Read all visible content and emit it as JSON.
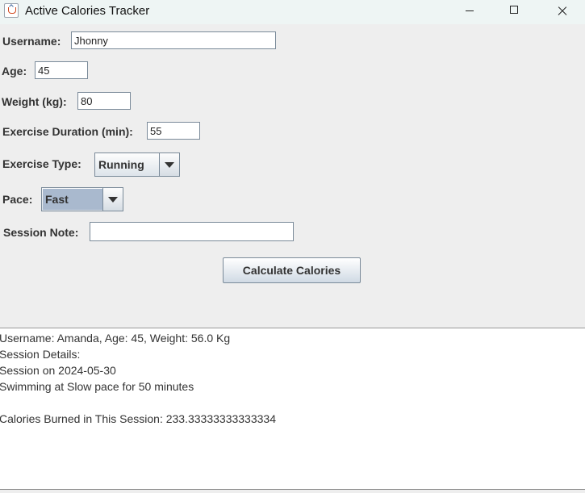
{
  "window": {
    "title": "Active Calories Tracker"
  },
  "form": {
    "username_label": "Username:",
    "username_value": "Jhonny",
    "age_label": "Age:",
    "age_value": "45",
    "weight_label": "Weight (kg):",
    "weight_value": "80",
    "duration_label": "Exercise Duration (min):",
    "duration_value": "55",
    "exercise_type_label": "Exercise Type:",
    "exercise_type_value": "Running",
    "pace_label": "Pace:",
    "pace_value": "Fast",
    "note_label": "Session Note:",
    "note_value": "",
    "calculate_label": "Calculate Calories"
  },
  "output": {
    "lines": [
      "Username: Amanda, Age: 45, Weight: 56.0 Kg",
      "Session Details:",
      "Session on 2024-05-30",
      "Swimming at Slow pace for 50 minutes",
      "",
      "Calories Burned in This Session: 233.33333333333334"
    ]
  },
  "colors": {
    "window_background": "#eeeeee",
    "titlebar_background": "#eef5f4",
    "selected_combo_background": "#a9b9ce"
  },
  "icons": {
    "app": "java-cup-icon",
    "minimize": "minimize-icon",
    "maximize": "maximize-icon",
    "close": "close-icon",
    "dropdown": "dropdown-arrow-icon"
  }
}
